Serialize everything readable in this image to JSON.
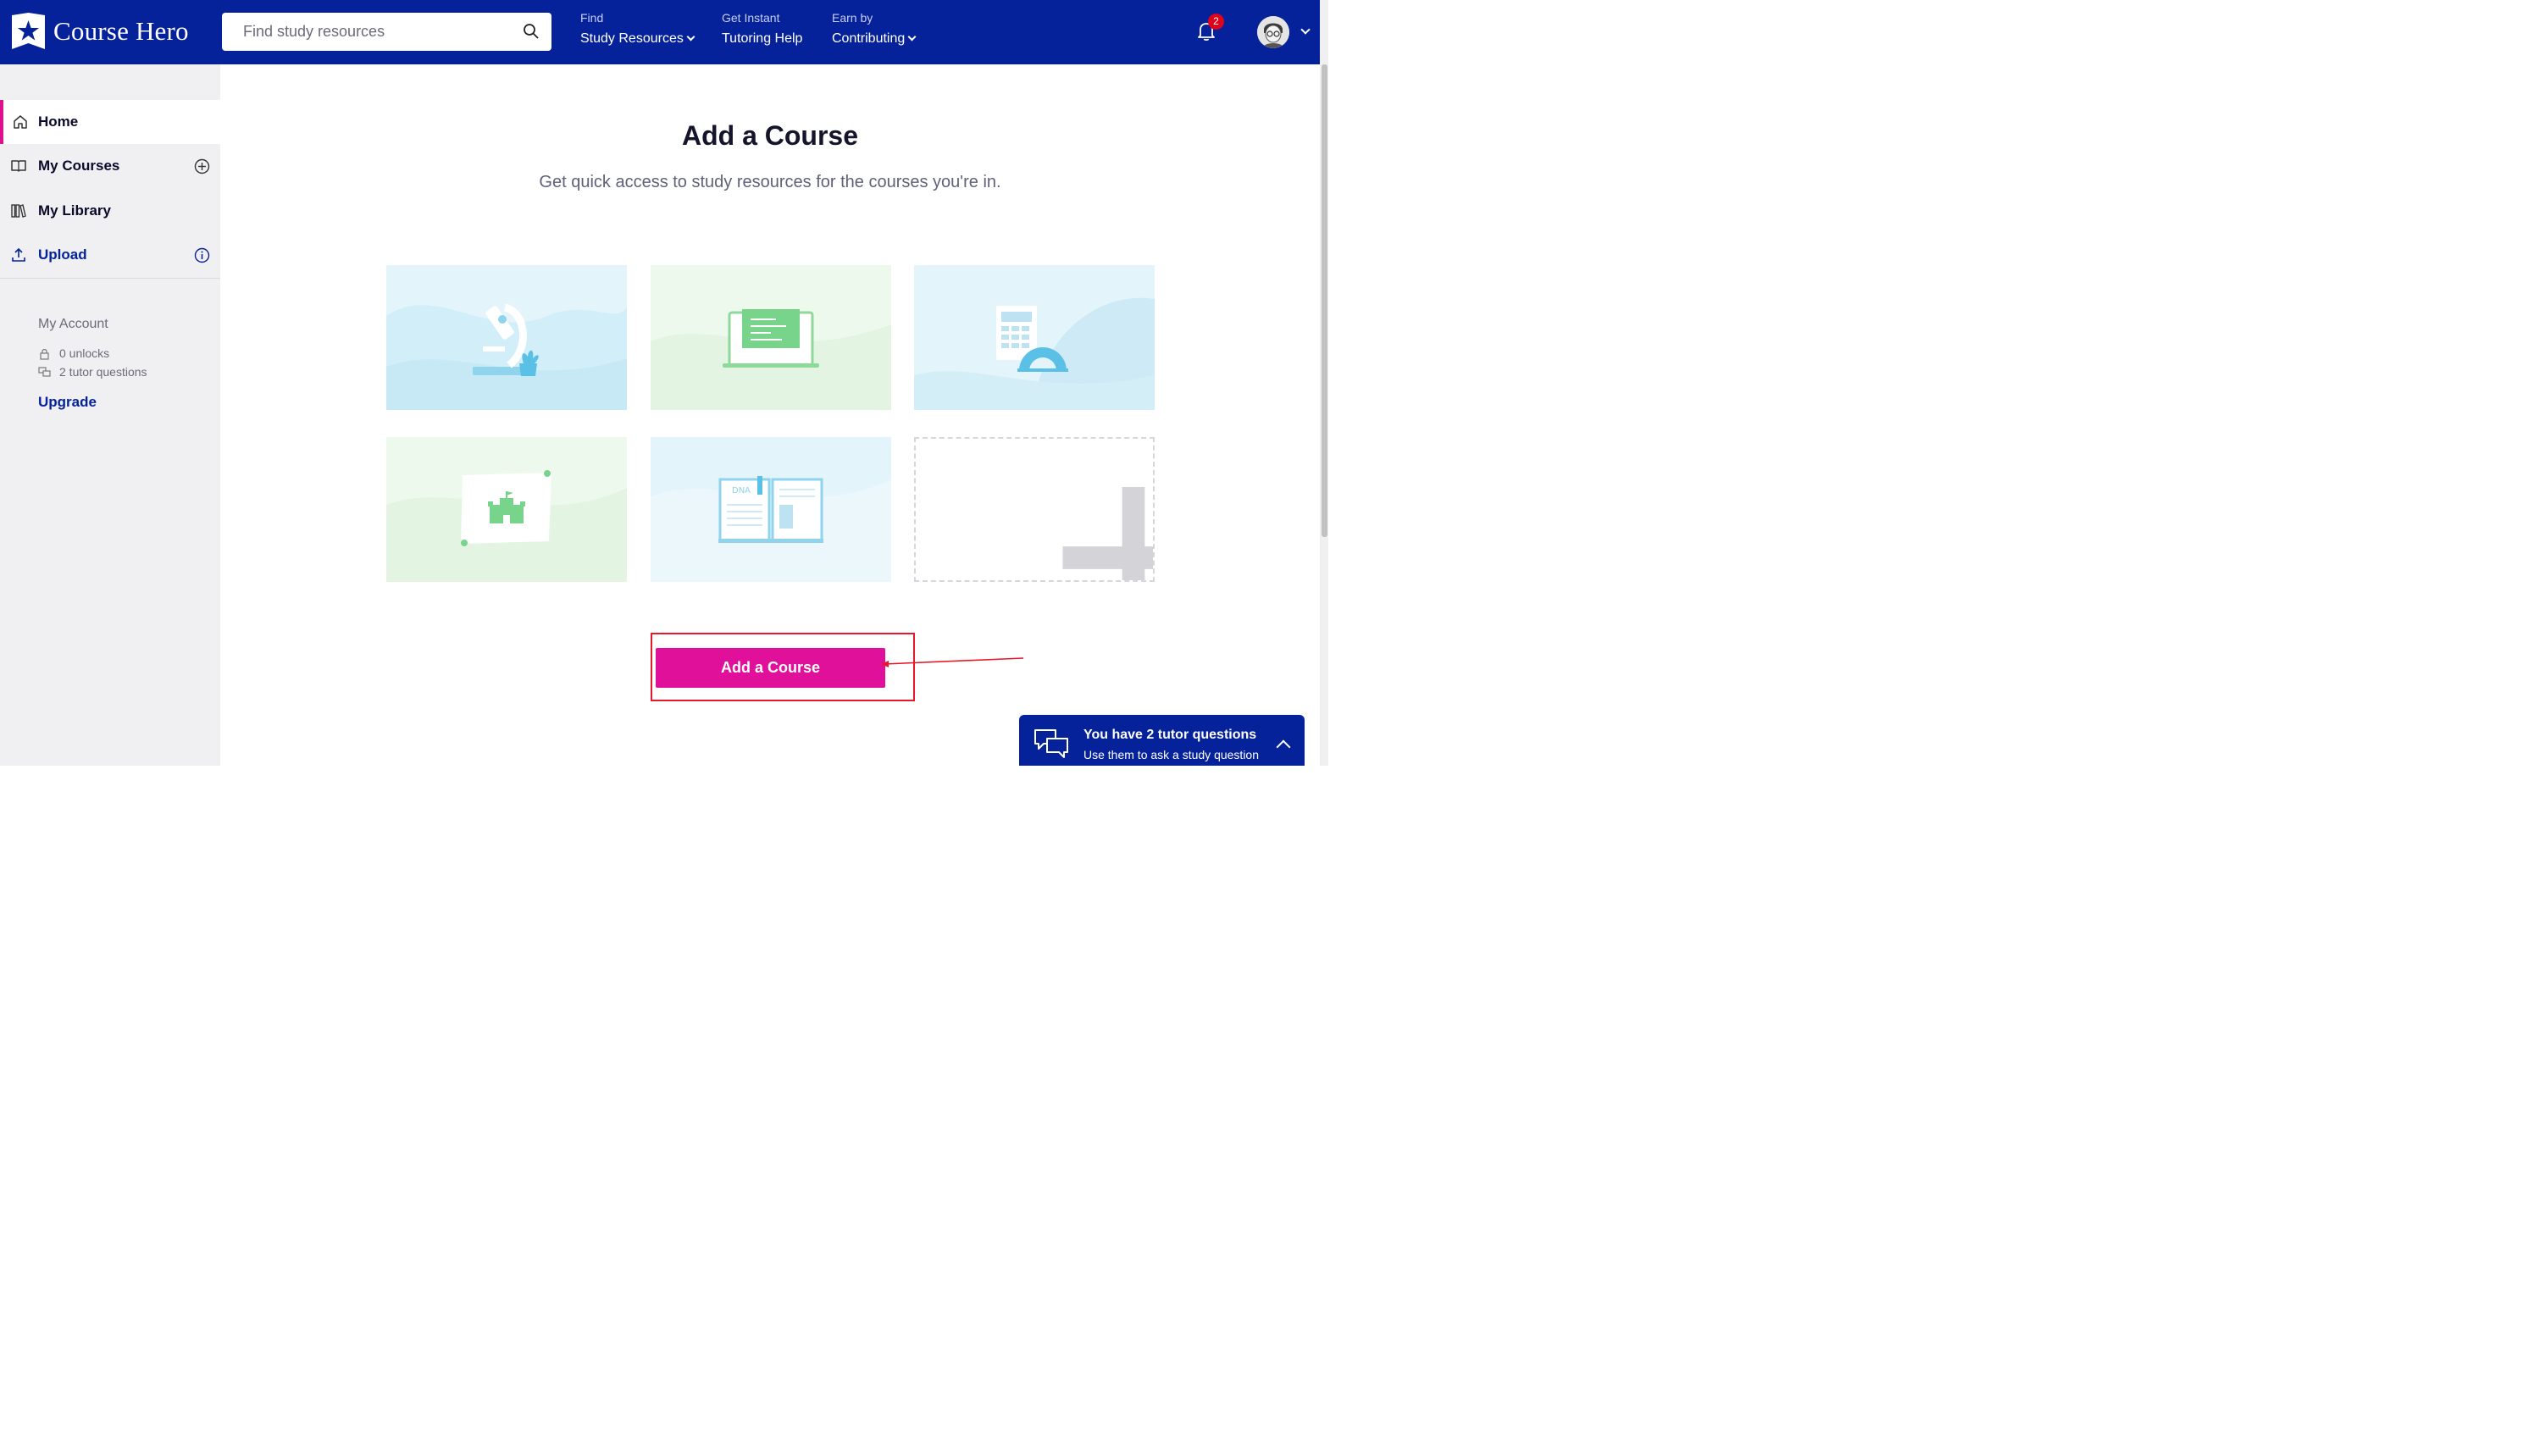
{
  "header": {
    "logo_text": "Course Hero",
    "search_placeholder": "Find study resources",
    "nav": [
      {
        "small": "Find",
        "big": "Study Resources",
        "has_dropdown": true
      },
      {
        "small": "Get Instant",
        "big": "Tutoring Help",
        "has_dropdown": false
      },
      {
        "small": "Earn by",
        "big": "Contributing",
        "has_dropdown": true
      }
    ],
    "notification_count": "2"
  },
  "sidebar": {
    "items": [
      {
        "label": "Home",
        "icon": "home-icon",
        "active": true
      },
      {
        "label": "My Courses",
        "icon": "book-icon",
        "right_icon": "plus-circle-icon"
      },
      {
        "label": "My Library",
        "icon": "library-icon"
      },
      {
        "label": "Upload",
        "icon": "upload-icon",
        "right_icon": "info-icon"
      }
    ],
    "account": {
      "title": "My Account",
      "unlocks": "0 unlocks",
      "tutor_questions": "2 tutor questions",
      "upgrade": "Upgrade"
    }
  },
  "main": {
    "title": "Add a Course",
    "subtitle": "Get quick access to study resources for the courses you're in.",
    "cards": [
      {
        "illustration": "microscope"
      },
      {
        "illustration": "laptop"
      },
      {
        "illustration": "calculator-protractor"
      },
      {
        "illustration": "castle-map"
      },
      {
        "illustration": "open-book"
      },
      {
        "illustration": "add-plus"
      }
    ],
    "add_button": "Add a Course"
  },
  "tutor_banner": {
    "title": "You have 2 tutor questions",
    "subtitle": "Use them to ask a study question"
  },
  "colors": {
    "brand_blue": "#05229a",
    "accent_pink": "#e0109a",
    "annotation_red": "#e8182a"
  }
}
